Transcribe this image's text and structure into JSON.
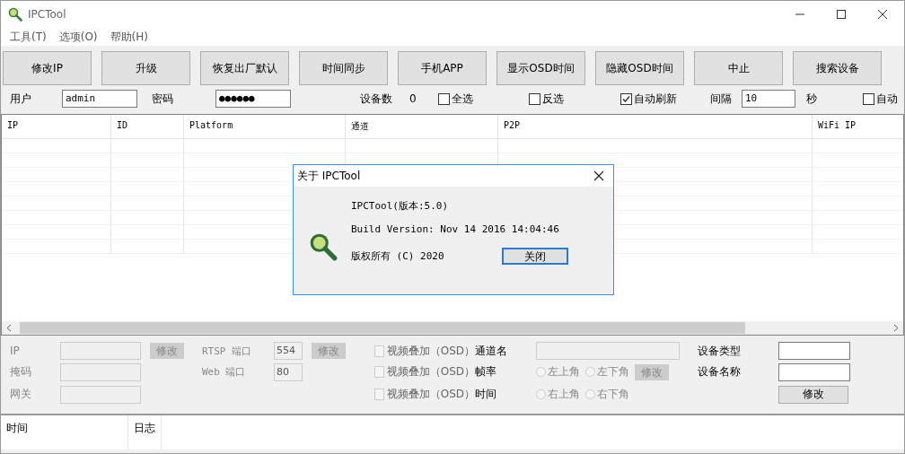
{
  "window": {
    "title": "IPCTool"
  },
  "menu": [
    {
      "label": "工具(T)"
    },
    {
      "label": "选项(O)"
    },
    {
      "label": "帮助(H)"
    }
  ],
  "toolbar": [
    {
      "label": "修改IP"
    },
    {
      "label": "升级"
    },
    {
      "label": "恢复出厂默认"
    },
    {
      "label": "时间同步"
    },
    {
      "label": "手机APP"
    },
    {
      "label": "显示OSD时间"
    },
    {
      "label": "隐藏OSD时间"
    },
    {
      "label": "中止"
    },
    {
      "label": "搜索设备"
    }
  ],
  "login": {
    "user_label": "用户",
    "user": "admin",
    "password_label": "密码",
    "password": "●●●●●●",
    "count_label": "设备数",
    "count": "0"
  },
  "options": [
    {
      "label": "全选",
      "checked": false
    },
    {
      "label": "反选",
      "checked": false
    },
    {
      "label": "自动刷新",
      "checked": true
    }
  ],
  "interval": {
    "label": "间隔",
    "value": "10",
    "unit": "秒"
  },
  "cut_option": {
    "label": "自动",
    "checked": false
  },
  "table": {
    "columns": [
      "IP",
      "ID",
      "Platform",
      "通道",
      "P2P",
      "WiFi IP"
    ]
  },
  "network": [
    {
      "label": "IP",
      "button": "修改",
      "disabled": true
    },
    {
      "label": "掩码",
      "disabled": true
    },
    {
      "label": "网关",
      "disabled": true
    }
  ],
  "ports": [
    {
      "label": "RTSP 端口",
      "value": "554",
      "button": "修改",
      "disabled": true
    },
    {
      "label": "Web 端口",
      "value": "80",
      "disabled": true
    }
  ],
  "osd": [
    {
      "kind": "field",
      "checkbox": "视频叠加（OSD）",
      "checked": false,
      "label": "通道名"
    },
    {
      "kind": "radios",
      "checkbox": "视频叠加（OSD）",
      "checked": false,
      "label": "帧率",
      "radios": [
        {
          "label": "左上角",
          "selected": false
        },
        {
          "label": "左下角",
          "selected": false
        }
      ],
      "button": "修改"
    },
    {
      "kind": "radios",
      "checkbox": "视频叠加（OSD）",
      "checked": false,
      "label": "时间",
      "radios": [
        {
          "label": "右上角",
          "selected": false
        },
        {
          "label": "右下角",
          "selected": false
        }
      ]
    }
  ],
  "device": {
    "type_label": "设备类型",
    "name_label": "设备名称",
    "button": "修改"
  },
  "log": {
    "columns": [
      "时间",
      "日志"
    ]
  },
  "dialog": {
    "title": "关于 IPCTool",
    "lines": [
      "IPCTool(版本:5.0)",
      "Build Version: Nov 14 2016 14:04:46",
      "版权所有 (C) 2020"
    ],
    "button": "关闭"
  }
}
